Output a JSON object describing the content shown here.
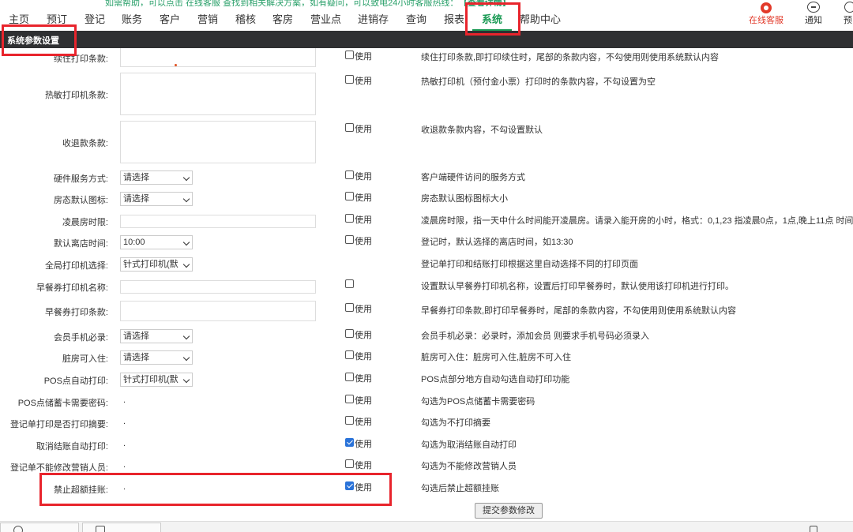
{
  "banner": {
    "text": "如需帮助，可以点击 在线客服 查找到相关解决方案，如有疑问，可以致电24小时客服热线：",
    "link": "【查看详情】"
  },
  "nav": {
    "items": [
      "主页",
      "预订",
      "登记",
      "账务",
      "客户",
      "营销",
      "稽核",
      "客房",
      "营业点",
      "进销存",
      "查询",
      "报表",
      "系统",
      "帮助中心"
    ],
    "active": "系统",
    "right": {
      "service": "在线客服",
      "notice": "通知",
      "pre": "预"
    }
  },
  "titlebar": "系统参数设置",
  "check_label": "使用",
  "rows": [
    {
      "label": "续住打印条款:",
      "control": "textarea",
      "checked": false,
      "desc": "续住打印条款,即打印续住时，尾部的条款内容，不勾使用则使用系统默认内容"
    },
    {
      "label": "热敏打印机条款:",
      "control": "textarea",
      "checked": false,
      "desc": "热敏打印机（预付金小票）打印时的条款内容，不勾设置为空"
    },
    {
      "label": "收退款条款:",
      "control": "textarea",
      "checked": false,
      "desc": "收退款条款内容，不勾设置默认"
    },
    {
      "label": "硬件服务方式:",
      "control": "select",
      "value": "请选择",
      "checked": false,
      "desc": "客户端硬件访问的服务方式"
    },
    {
      "label": "房态默认图标:",
      "control": "select",
      "value": "请选择",
      "checked": false,
      "desc": "房态默认图标图标大小"
    },
    {
      "label": "凌晨房时限:",
      "control": "text",
      "checked": false,
      "desc": "凌晨房时限，指一天中什么时间能开凌晨房。请录入能开房的小时，格式：0,1,23 指凌晨0点，1点,晚上11点 时间"
    },
    {
      "label": "默认离店时间:",
      "control": "select",
      "value": "10:00",
      "checked": false,
      "desc": "登记时，默认选择的离店时间，如13:30"
    },
    {
      "label": "全局打印机选择:",
      "control": "select",
      "value": "针式打印机(默",
      "checked": null,
      "desc": "登记单打印和结账打印根据这里自动选择不同的打印页面"
    },
    {
      "label": "早餐券打印机名称:",
      "control": "text",
      "checked": false,
      "nolabel": true,
      "desc": "设置默认早餐券打印机名称，设置后打印早餐券时，默认使用该打印机进行打印。"
    },
    {
      "label": "早餐券打印条款:",
      "control": "text",
      "checked": false,
      "desc": "早餐券打印条款,即打印早餐券时，尾部的条款内容，不勾使用则使用系统默认内容"
    },
    {
      "label": "会员手机必录:",
      "control": "select",
      "value": "请选择",
      "checked": false,
      "desc": "会员手机必录：必录时，添加会员 则要求手机号码必须录入"
    },
    {
      "label": "脏房可入住:",
      "control": "select",
      "value": "请选择",
      "checked": false,
      "desc": "脏房可入住：脏房可入住,脏房不可入住"
    },
    {
      "label": "POS点自动打印:",
      "control": "select",
      "value": "针式打印机(默",
      "checked": false,
      "desc": "POS点部分地方自动勾选自动打印功能"
    },
    {
      "label": "POS点储蓄卡需要密码:",
      "control": "dot",
      "value": ".",
      "checked": false,
      "desc": "勾选为POS点储蓄卡需要密码"
    },
    {
      "label": "登记单打印是否打印摘要:",
      "control": "dot",
      "value": ".",
      "checked": false,
      "desc": "勾选为不打印摘要"
    },
    {
      "label": "取消结账自动打印:",
      "control": "dot",
      "value": ".",
      "checked": true,
      "desc": "勾选为取消结账自动打印"
    },
    {
      "label": "登记单不能修改营销人员:",
      "control": "dot",
      "value": ".",
      "checked": false,
      "desc": "勾选为不能修改营销人员"
    },
    {
      "label": "禁止超额挂账:",
      "control": "dot",
      "value": ".",
      "checked": true,
      "desc": "勾选后禁止超额挂账"
    }
  ],
  "submit_label": "提交参数修改",
  "colors": {
    "accent_green": "#1a9a54",
    "titlebar_bg": "#2f3032",
    "annotation_red": "#e8242c",
    "checkbox_blue": "#2a73d9"
  }
}
